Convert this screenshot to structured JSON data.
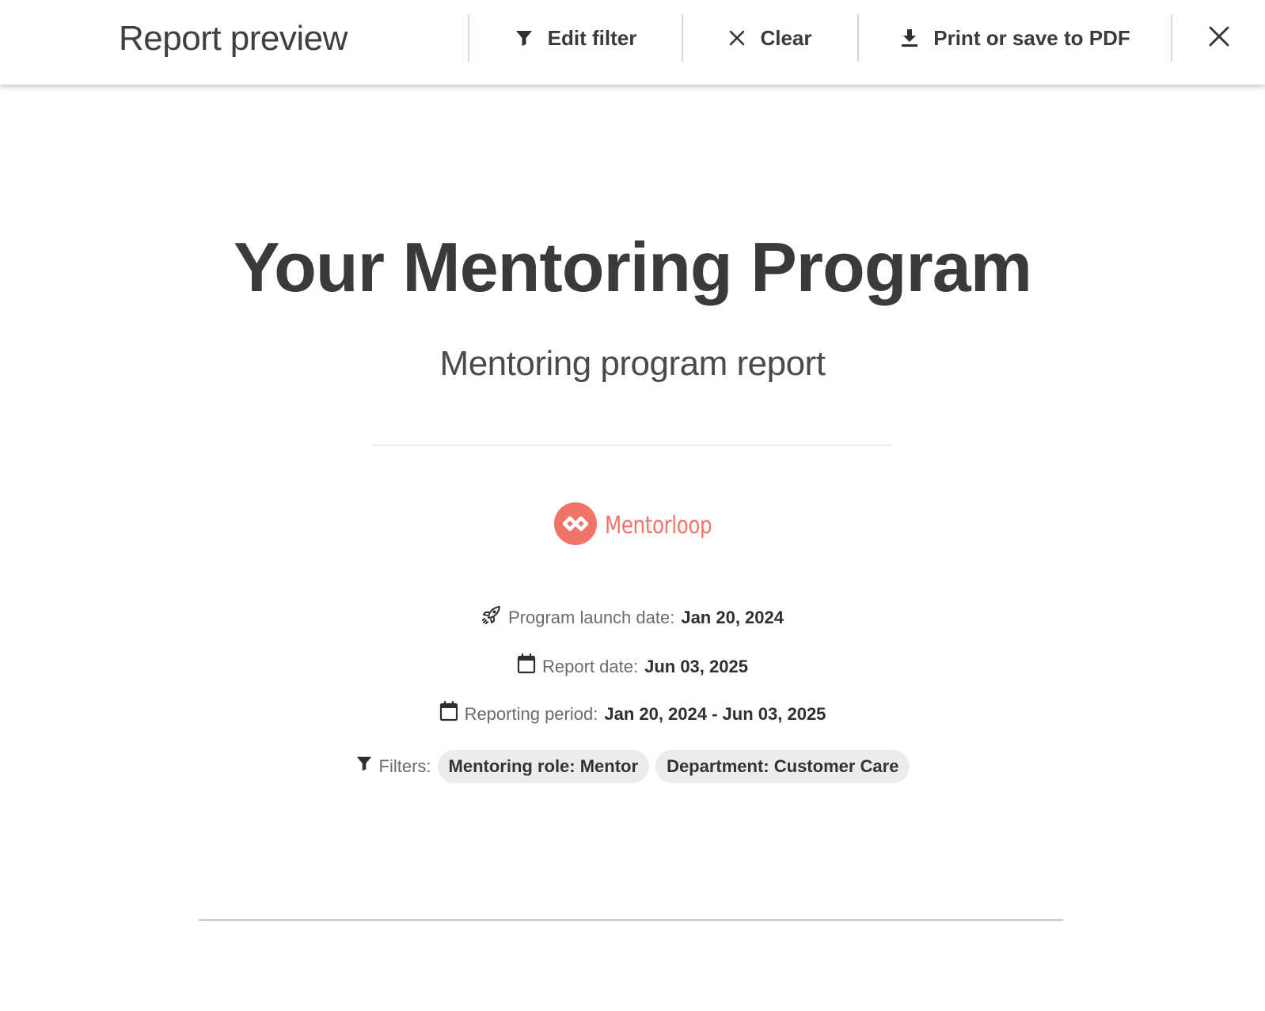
{
  "toolbar": {
    "title": "Report preview",
    "edit_filter_label": "Edit filter",
    "clear_label": "Clear",
    "print_label": "Print or save to PDF",
    "icons": {
      "edit_filter": "filter-icon",
      "clear": "clear-x-icon",
      "print": "download-icon",
      "close": "close-icon"
    }
  },
  "report": {
    "title": "Your Mentoring Program",
    "subtitle": "Mentoring program report",
    "logo_text": "Mentorloop",
    "brand_color": "#f07468",
    "launch_label": "Program launch date:",
    "launch_value": "Jan 20, 2024",
    "report_date_label": "Report date:",
    "report_date_value": "Jun 03, 2025",
    "period_label": "Reporting period:",
    "period_value": "Jan 20, 2024 - Jun 03, 2025",
    "filters_label": "Filters:",
    "filters": [
      "Mentoring role: Mentor",
      "Department: Customer Care"
    ],
    "icons": {
      "launch": "rocket-icon",
      "report_date": "calendar-icon",
      "period": "calendar-icon",
      "filters": "filter-icon"
    }
  }
}
